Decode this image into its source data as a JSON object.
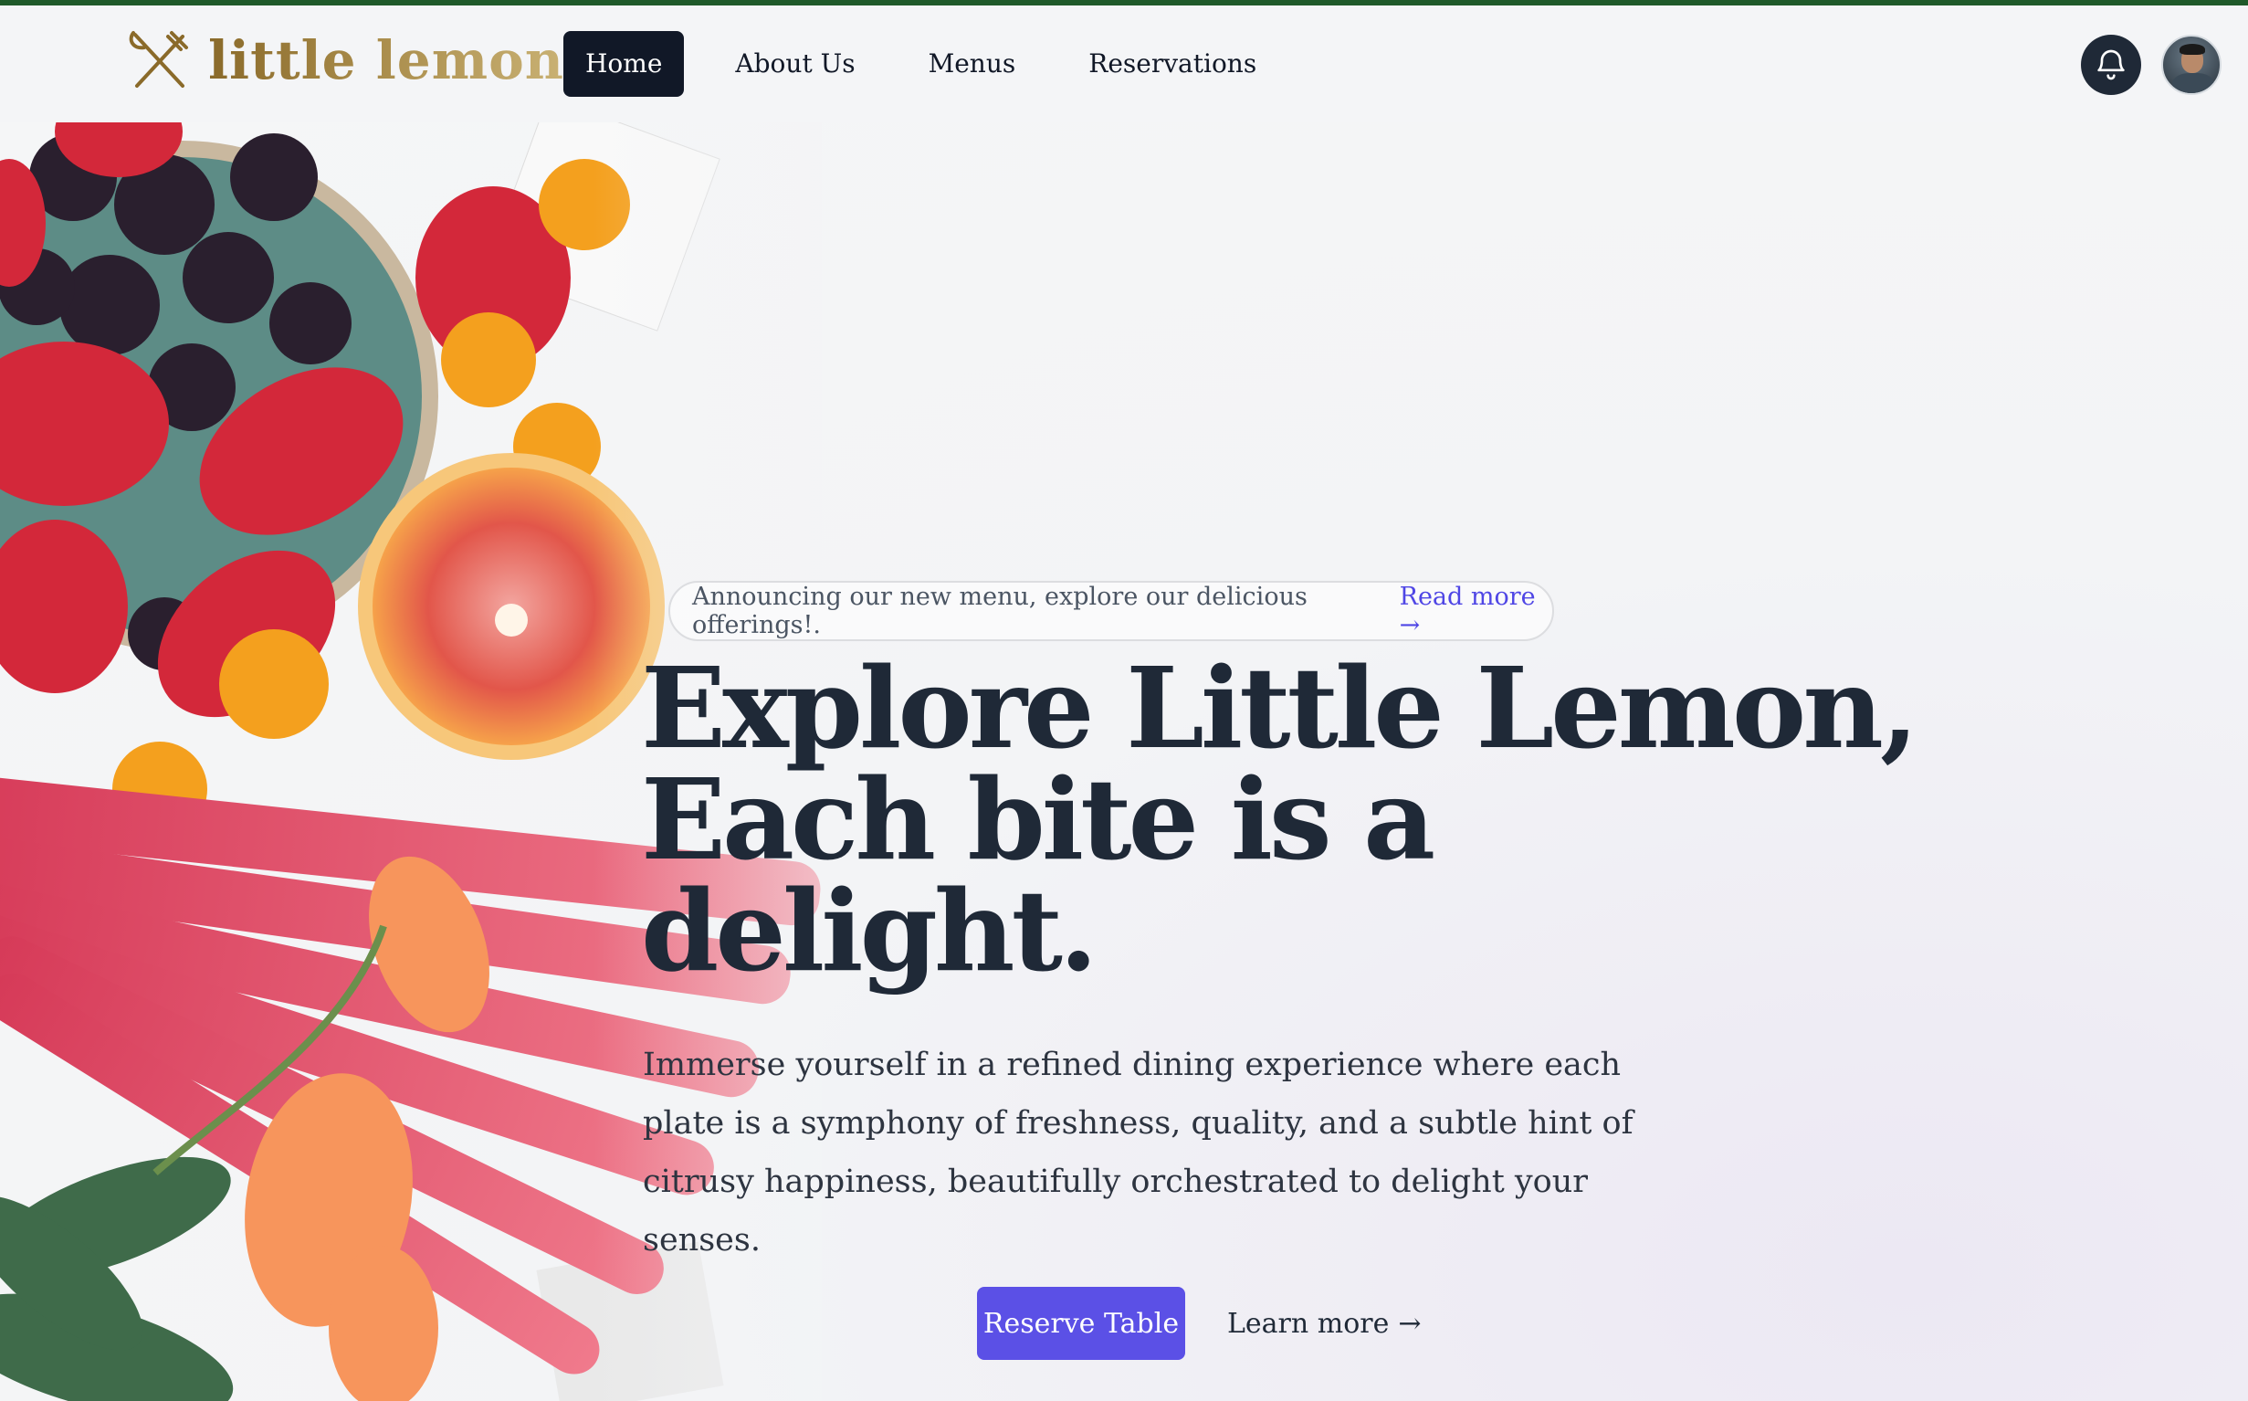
{
  "brand": {
    "name": "little lemon",
    "logo_icon": "fork-knife-icon"
  },
  "nav": {
    "items": [
      {
        "label": "Home",
        "active": true
      },
      {
        "label": "About Us",
        "active": false
      },
      {
        "label": "Menus",
        "active": false
      },
      {
        "label": "Reservations",
        "active": false
      }
    ]
  },
  "header_actions": {
    "notification_icon": "bell-icon",
    "avatar_icon": "user-avatar"
  },
  "hero": {
    "announcement": "Announcing our new menu, explore our delicious offerings!.",
    "announcement_link": "Read more",
    "headline_line1": "Explore Little Lemon,",
    "headline_line2": "Each bite is a delight.",
    "lead": "Immerse yourself in a refined dining experience where each plate is a symphony of freshness, quality, and a subtle hint of citrusy happiness, beautifully orchestrated to delight your senses.",
    "primary_button": "Reserve Table",
    "secondary_link": "Learn more",
    "arrow": "→"
  },
  "colors": {
    "accent": "#5b50e6",
    "dark": "#111827",
    "top_line": "#1f5a2a",
    "logo_gold": "#a88b4a"
  }
}
